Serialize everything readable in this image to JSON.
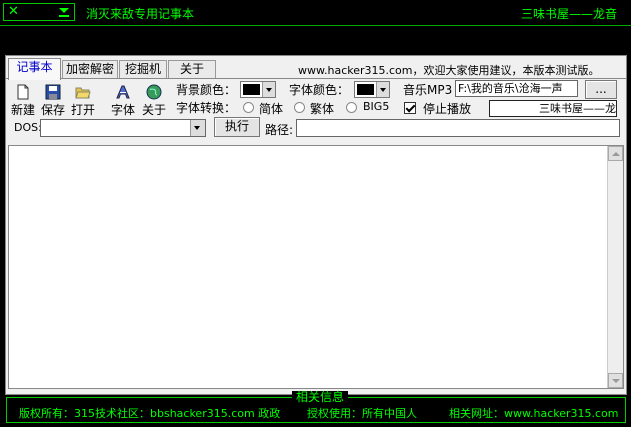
{
  "titlebar": {
    "close_glyph": "✕",
    "title": "消灭来敌专用记事本",
    "brand": "三味书屋——龙音"
  },
  "tabs": [
    {
      "label": "记事本"
    },
    {
      "label": "加密解密"
    },
    {
      "label": "挖掘机"
    },
    {
      "label": "关于"
    }
  ],
  "notice": "www.hacker315.com，欢迎大家使用建议，本版本测试版。",
  "toolbar": {
    "new_label": "新建",
    "save_label": "保存",
    "open_label": "打开",
    "font_label": "字体",
    "about_label": "关于"
  },
  "options": {
    "bg_color_label": "背景颜色：",
    "font_color_label": "字体颜色：",
    "music_label": "音乐MP3",
    "music_path": "F:\\我的音乐\\沧海一声",
    "browse_label": "...",
    "convert_label": "字体转换：",
    "simplified": "简体",
    "traditional": "繁体",
    "big5": "BIG5",
    "stop_label": "停止播放",
    "marquee": "三味书屋——龙"
  },
  "command": {
    "dos_label": "DOS:",
    "run_label": "执行",
    "path_label": "路径:"
  },
  "footer": {
    "title": "相关信息",
    "copyright": "版权所有：315技术社区：bbshacker315.com 政政",
    "license": "授权使用：所有中国人",
    "url": "相关网址：www.hacker315.com"
  },
  "colors": {
    "accent": "#00ff00",
    "background": "#000000",
    "panel": "#f0f0f0",
    "active_tab": "#0000cc"
  }
}
